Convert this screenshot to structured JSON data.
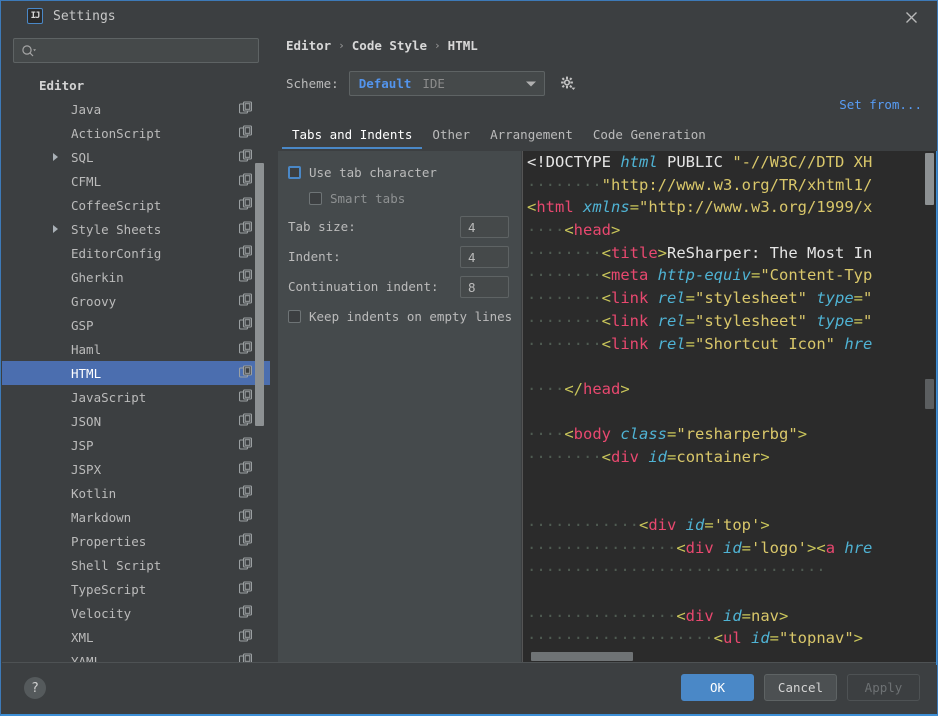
{
  "window": {
    "title": "Settings",
    "logo_text": "IJ",
    "close_icon": "close-icon"
  },
  "sidebar": {
    "search": {
      "value": "",
      "placeholder": "",
      "icon": "search-icon"
    },
    "tree": [
      {
        "label": "Editor",
        "level": 0,
        "arrow": false,
        "copy": false,
        "selected": false,
        "group": true
      },
      {
        "label": "Java",
        "level": 1,
        "arrow": false,
        "copy": true,
        "selected": false
      },
      {
        "label": "ActionScript",
        "level": 1,
        "arrow": false,
        "copy": true,
        "selected": false
      },
      {
        "label": "SQL",
        "level": 1,
        "arrow": true,
        "copy": true,
        "selected": false
      },
      {
        "label": "CFML",
        "level": 1,
        "arrow": false,
        "copy": true,
        "selected": false
      },
      {
        "label": "CoffeeScript",
        "level": 1,
        "arrow": false,
        "copy": true,
        "selected": false
      },
      {
        "label": "Style Sheets",
        "level": 1,
        "arrow": true,
        "copy": true,
        "selected": false
      },
      {
        "label": "EditorConfig",
        "level": 1,
        "arrow": false,
        "copy": true,
        "selected": false
      },
      {
        "label": "Gherkin",
        "level": 1,
        "arrow": false,
        "copy": true,
        "selected": false
      },
      {
        "label": "Groovy",
        "level": 1,
        "arrow": false,
        "copy": true,
        "selected": false
      },
      {
        "label": "GSP",
        "level": 1,
        "arrow": false,
        "copy": true,
        "selected": false
      },
      {
        "label": "Haml",
        "level": 1,
        "arrow": false,
        "copy": true,
        "selected": false
      },
      {
        "label": "HTML",
        "level": 1,
        "arrow": false,
        "copy": true,
        "selected": true
      },
      {
        "label": "JavaScript",
        "level": 1,
        "arrow": false,
        "copy": true,
        "selected": false
      },
      {
        "label": "JSON",
        "level": 1,
        "arrow": false,
        "copy": true,
        "selected": false
      },
      {
        "label": "JSP",
        "level": 1,
        "arrow": false,
        "copy": true,
        "selected": false
      },
      {
        "label": "JSPX",
        "level": 1,
        "arrow": false,
        "copy": true,
        "selected": false
      },
      {
        "label": "Kotlin",
        "level": 1,
        "arrow": false,
        "copy": true,
        "selected": false
      },
      {
        "label": "Markdown",
        "level": 1,
        "arrow": false,
        "copy": true,
        "selected": false
      },
      {
        "label": "Properties",
        "level": 1,
        "arrow": false,
        "copy": true,
        "selected": false
      },
      {
        "label": "Shell Script",
        "level": 1,
        "arrow": false,
        "copy": true,
        "selected": false
      },
      {
        "label": "TypeScript",
        "level": 1,
        "arrow": false,
        "copy": true,
        "selected": false
      },
      {
        "label": "Velocity",
        "level": 1,
        "arrow": false,
        "copy": true,
        "selected": false
      },
      {
        "label": "XML",
        "level": 1,
        "arrow": false,
        "copy": true,
        "selected": false
      },
      {
        "label": "YAML",
        "level": 1,
        "arrow": false,
        "copy": true,
        "selected": false
      }
    ]
  },
  "content": {
    "breadcrumb": [
      "Editor",
      "Code Style",
      "HTML"
    ],
    "breadcrumb_separator": "›",
    "scheme": {
      "label": "Scheme:",
      "value": "Default",
      "scope": "IDE",
      "gear_icon": "gear-icon"
    },
    "set_from": "Set from...",
    "tabs": [
      {
        "label": "Tabs and Indents",
        "active": true
      },
      {
        "label": "Other",
        "active": false
      },
      {
        "label": "Arrangement",
        "active": false
      },
      {
        "label": "Code Generation",
        "active": false
      }
    ],
    "options": {
      "use_tab_character": {
        "label": "Use tab character",
        "checked": false,
        "focused": true
      },
      "smart_tabs": {
        "label": "Smart tabs",
        "checked": false,
        "disabled": true
      },
      "tab_size": {
        "label": "Tab size:",
        "value": "4"
      },
      "indent": {
        "label": "Indent:",
        "value": "4"
      },
      "continuation": {
        "label": "Continuation indent:",
        "value": "8"
      },
      "keep_indents": {
        "label": "Keep indents on empty lines",
        "checked": false
      }
    },
    "preview_code": [
      [
        [
          "tx",
          "<!DOCTYPE "
        ],
        [
          "at",
          "html"
        ],
        [
          "tx",
          " PUBLIC "
        ],
        [
          "st",
          "\"-//W3C//DTD XH"
        ]
      ],
      [
        [
          "ws",
          "········"
        ],
        [
          "st",
          "\"http://www.w3.org/TR/xhtml1/"
        ]
      ],
      [
        [
          "br",
          "<"
        ],
        [
          "tg",
          "html"
        ],
        [
          "tx",
          " "
        ],
        [
          "at",
          "xmlns"
        ],
        [
          "br",
          "="
        ],
        [
          "st",
          "\"http://www.w3.org/1999/x"
        ]
      ],
      [
        [
          "ws",
          "····"
        ],
        [
          "br",
          "<"
        ],
        [
          "tg",
          "head"
        ],
        [
          "br",
          ">"
        ]
      ],
      [
        [
          "ws",
          "········"
        ],
        [
          "br",
          "<"
        ],
        [
          "tg",
          "title"
        ],
        [
          "br",
          ">"
        ],
        [
          "tx",
          "ReSharper: The Most In"
        ]
      ],
      [
        [
          "ws",
          "········"
        ],
        [
          "br",
          "<"
        ],
        [
          "tg",
          "meta"
        ],
        [
          "tx",
          " "
        ],
        [
          "at",
          "http-equiv"
        ],
        [
          "br",
          "="
        ],
        [
          "st",
          "\"Content-Typ"
        ]
      ],
      [
        [
          "ws",
          "········"
        ],
        [
          "br",
          "<"
        ],
        [
          "tg",
          "link"
        ],
        [
          "tx",
          " "
        ],
        [
          "at",
          "rel"
        ],
        [
          "br",
          "="
        ],
        [
          "st",
          "\"stylesheet\""
        ],
        [
          "tx",
          " "
        ],
        [
          "at",
          "type"
        ],
        [
          "br",
          "="
        ],
        [
          "st",
          "\""
        ]
      ],
      [
        [
          "ws",
          "········"
        ],
        [
          "br",
          "<"
        ],
        [
          "tg",
          "link"
        ],
        [
          "tx",
          " "
        ],
        [
          "at",
          "rel"
        ],
        [
          "br",
          "="
        ],
        [
          "st",
          "\"stylesheet\""
        ],
        [
          "tx",
          " "
        ],
        [
          "at",
          "type"
        ],
        [
          "br",
          "="
        ],
        [
          "st",
          "\""
        ]
      ],
      [
        [
          "ws",
          "········"
        ],
        [
          "br",
          "<"
        ],
        [
          "tg",
          "link"
        ],
        [
          "tx",
          " "
        ],
        [
          "at",
          "rel"
        ],
        [
          "br",
          "="
        ],
        [
          "st",
          "\"Shortcut Icon\""
        ],
        [
          "tx",
          " "
        ],
        [
          "at",
          "hre"
        ]
      ],
      [
        [
          "ws",
          ""
        ]
      ],
      [
        [
          "ws",
          "····"
        ],
        [
          "br",
          "</"
        ],
        [
          "tg",
          "head"
        ],
        [
          "br",
          ">"
        ]
      ],
      [
        [
          "ws",
          ""
        ]
      ],
      [
        [
          "ws",
          "····"
        ],
        [
          "br",
          "<"
        ],
        [
          "tg",
          "body"
        ],
        [
          "tx",
          " "
        ],
        [
          "at",
          "class"
        ],
        [
          "br",
          "="
        ],
        [
          "st",
          "\"resharperbg\""
        ],
        [
          "br",
          ">"
        ]
      ],
      [
        [
          "ws",
          "········"
        ],
        [
          "br",
          "<"
        ],
        [
          "tg",
          "div"
        ],
        [
          "tx",
          " "
        ],
        [
          "at",
          "id"
        ],
        [
          "br",
          "="
        ],
        [
          "st",
          "container"
        ],
        [
          "br",
          ">"
        ]
      ],
      [
        [
          "ws",
          ""
        ]
      ],
      [
        [
          "ws",
          ""
        ]
      ],
      [
        [
          "ws",
          "············"
        ],
        [
          "br",
          "<"
        ],
        [
          "tg",
          "div"
        ],
        [
          "tx",
          " "
        ],
        [
          "at",
          "id"
        ],
        [
          "br",
          "="
        ],
        [
          "st",
          "'top'"
        ],
        [
          "br",
          ">"
        ]
      ],
      [
        [
          "ws",
          "················"
        ],
        [
          "br",
          "<"
        ],
        [
          "tg",
          "div"
        ],
        [
          "tx",
          " "
        ],
        [
          "at",
          "id"
        ],
        [
          "br",
          "="
        ],
        [
          "st",
          "'logo'"
        ],
        [
          "br",
          ">"
        ],
        [
          "br",
          "<"
        ],
        [
          "tg",
          "a"
        ],
        [
          "tx",
          " "
        ],
        [
          "at",
          "hre"
        ]
      ],
      [
        [
          "ws",
          "································"
        ]
      ],
      [
        [
          "ws",
          ""
        ]
      ],
      [
        [
          "ws",
          "················"
        ],
        [
          "br",
          "<"
        ],
        [
          "tg",
          "div"
        ],
        [
          "tx",
          " "
        ],
        [
          "at",
          "id"
        ],
        [
          "br",
          "="
        ],
        [
          "st",
          "nav"
        ],
        [
          "br",
          ">"
        ]
      ],
      [
        [
          "ws",
          "····················"
        ],
        [
          "br",
          "<"
        ],
        [
          "tg",
          "ul"
        ],
        [
          "tx",
          " "
        ],
        [
          "at",
          "id"
        ],
        [
          "br",
          "="
        ],
        [
          "st",
          "\"topnav\""
        ],
        [
          "br",
          ">"
        ]
      ]
    ]
  },
  "footer": {
    "help_label": "?",
    "ok": "OK",
    "cancel": "Cancel",
    "apply": "Apply"
  },
  "colors": {
    "accent": "#4a88c7",
    "selection": "#4b6eaf",
    "link": "#589df6",
    "dialog_bg": "#3c3f41",
    "panel_bg": "#454a4c",
    "editor_bg": "#2b2b2b"
  }
}
